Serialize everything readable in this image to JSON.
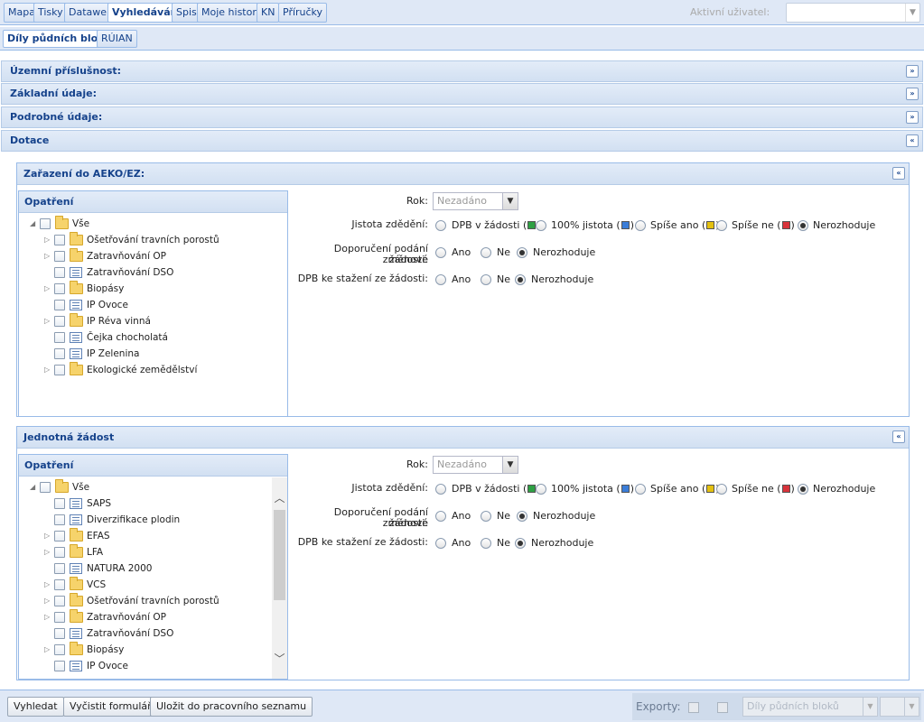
{
  "top_tabs": [
    {
      "label": "Mapa"
    },
    {
      "label": "Tisky"
    },
    {
      "label": "Datawell"
    },
    {
      "label": "Vyhledávání"
    },
    {
      "label": "Spis"
    },
    {
      "label": "Moje historie"
    },
    {
      "label": "KN"
    },
    {
      "label": "Příručky"
    }
  ],
  "user": {
    "label": "Aktivní uživatel:",
    "value": ""
  },
  "sub_tabs": [
    {
      "label": "Díly půdních bloků"
    },
    {
      "label": "RÚIAN"
    }
  ],
  "sections": [
    {
      "title": "Územní příslušnost:",
      "toggle": "»"
    },
    {
      "title": "Základní údaje:",
      "toggle": "»"
    },
    {
      "title": "Podrobné údaje:",
      "toggle": "»"
    },
    {
      "title": "Dotace",
      "toggle": "«"
    }
  ],
  "aeko": {
    "title": "Zařazení do AEKO/EZ:",
    "tree_title": "Opatření",
    "tree": [
      {
        "label": "Vše",
        "type": "folder",
        "expanded": true
      },
      {
        "label": "Ošetřování travních porostů",
        "type": "folder"
      },
      {
        "label": "Zatravňování OP",
        "type": "folder"
      },
      {
        "label": "Zatravňování DSO",
        "type": "leaf"
      },
      {
        "label": "Biopásy",
        "type": "folder"
      },
      {
        "label": "IP Ovoce",
        "type": "leaf"
      },
      {
        "label": "IP Réva vinná",
        "type": "folder"
      },
      {
        "label": "Čejka chocholatá",
        "type": "leaf"
      },
      {
        "label": "IP Zelenina",
        "type": "leaf"
      },
      {
        "label": "Ekologické zemědělství",
        "type": "folder"
      }
    ]
  },
  "jz": {
    "title": "Jednotná žádost",
    "tree_title": "Opatření",
    "tree": [
      {
        "label": "Vše",
        "type": "folder",
        "expanded": true
      },
      {
        "label": "SAPS",
        "type": "leaf"
      },
      {
        "label": "Diverzifikace plodin",
        "type": "leaf"
      },
      {
        "label": "EFAS",
        "type": "folder"
      },
      {
        "label": "LFA",
        "type": "folder"
      },
      {
        "label": "NATURA 2000",
        "type": "leaf"
      },
      {
        "label": "VCS",
        "type": "folder"
      },
      {
        "label": "Ošetřování travních porostů",
        "type": "folder"
      },
      {
        "label": "Zatravňování OP",
        "type": "folder"
      },
      {
        "label": "Zatravňování DSO",
        "type": "leaf"
      },
      {
        "label": "Biopásy",
        "type": "folder"
      },
      {
        "label": "IP Ovoce",
        "type": "leaf"
      }
    ]
  },
  "form": {
    "rok_label": "Rok:",
    "rok_value": "Nezadáno",
    "jistota_label": "Jistota zdědění:",
    "jistota_options": [
      "DPB v žádosti (",
      "100% jistota (",
      "Spíše ano (",
      "Spíše ne (",
      "Nerozhoduje"
    ],
    "jistota_close": ")",
    "doporuceni_label_1": "Doporučení podání změnové",
    "doporuceni_label_2": "žádosti:",
    "stazeni_label": "DPB ke stažení ze žádosti:",
    "yes": "Ano",
    "no": "Ne",
    "neutral": "Nerozhoduje"
  },
  "colors": {
    "green": "#2ea043",
    "blue": "#3b7dd8",
    "yellow": "#e3c010",
    "red": "#d8333b"
  },
  "bottom": {
    "search": "Vyhledat",
    "clear": "Vyčistit formulář",
    "save": "Uložit do pracovního seznamu",
    "exports_label": "Exporty:",
    "export_combo": "Díly půdních bloků"
  }
}
